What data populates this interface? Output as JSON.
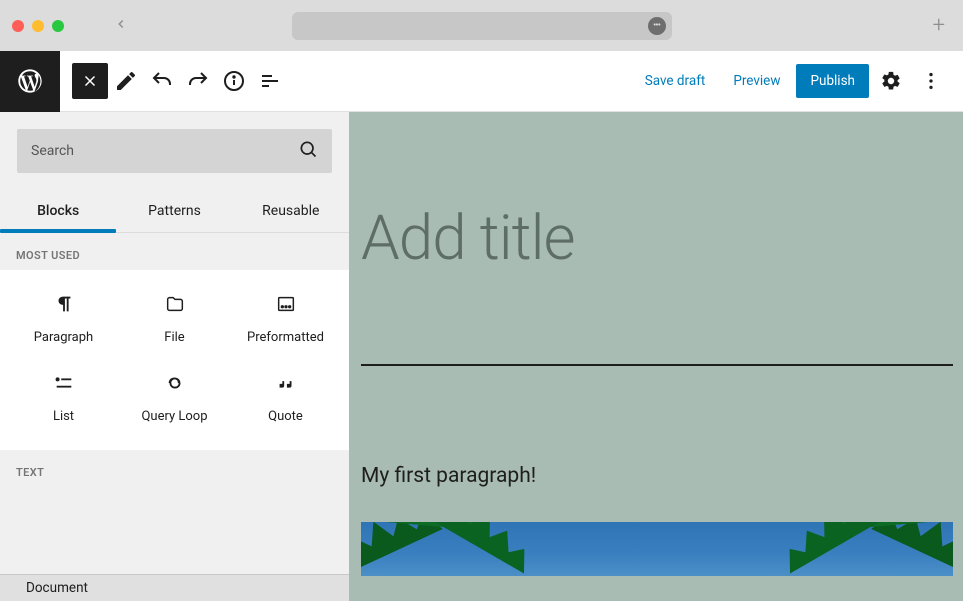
{
  "toolbar": {
    "save_draft": "Save draft",
    "preview": "Preview",
    "publish": "Publish"
  },
  "inserter": {
    "search_placeholder": "Search",
    "tabs": {
      "blocks": "Blocks",
      "patterns": "Patterns",
      "reusable": "Reusable"
    },
    "sections": {
      "most_used": "MOST USED",
      "text": "TEXT"
    },
    "blocks": [
      {
        "label": "Paragraph"
      },
      {
        "label": "File"
      },
      {
        "label": "Preformatted"
      },
      {
        "label": "List"
      },
      {
        "label": "Query Loop"
      },
      {
        "label": "Quote"
      }
    ]
  },
  "editor": {
    "title_placeholder": "Add title",
    "paragraph": "My first paragraph!"
  },
  "footer": {
    "document": "Document"
  }
}
